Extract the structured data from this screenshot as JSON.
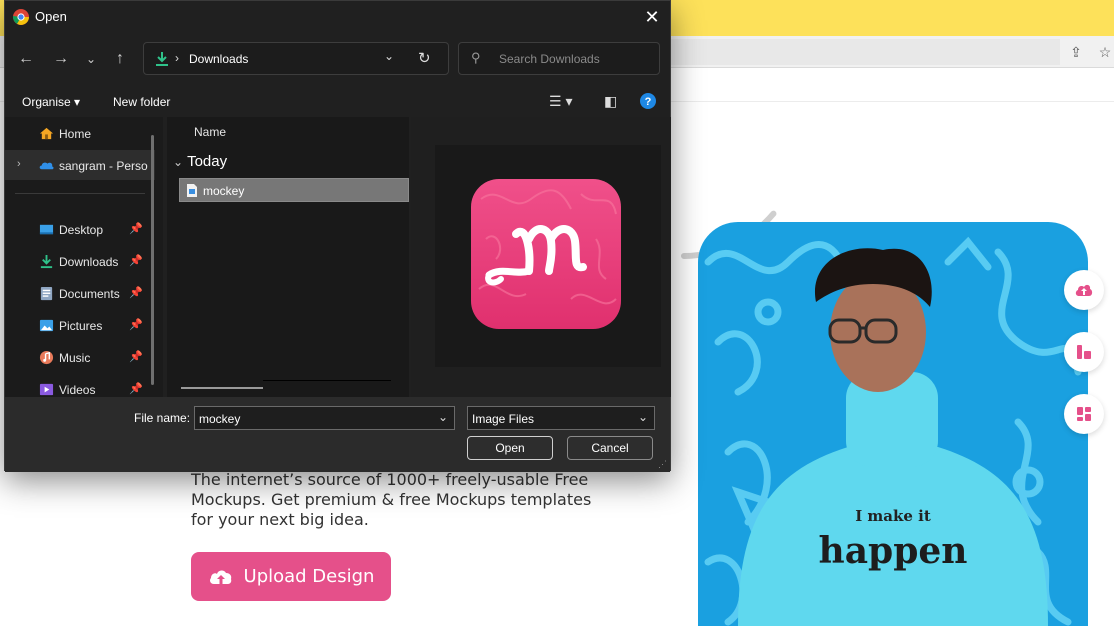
{
  "dialog": {
    "title": "Open",
    "address": {
      "location": "Downloads",
      "separator": "›"
    },
    "search": {
      "placeholder": "Search Downloads"
    },
    "commands": {
      "organise": "Organise",
      "new_folder": "New folder"
    },
    "nav_items": [
      {
        "label": "Home"
      },
      {
        "label": "sangram - Perso"
      },
      {
        "label": "Desktop"
      },
      {
        "label": "Downloads"
      },
      {
        "label": "Documents"
      },
      {
        "label": "Pictures"
      },
      {
        "label": "Music"
      },
      {
        "label": "Videos"
      }
    ],
    "file_list": {
      "column_name": "Name",
      "group": "Today",
      "files": [
        {
          "name": "mockey"
        }
      ]
    },
    "bottom": {
      "file_name_label": "File name:",
      "file_name_value": "mockey",
      "file_type": "Image Files",
      "open_label": "Open",
      "cancel_label": "Cancel"
    }
  },
  "page": {
    "hero_text": "The internet’s source of 1000+ freely-usable Free Mockups. Get premium & free Mockups templates for your next big idea.",
    "upload_button": "Upload Design",
    "tshirt_text_1": "I make it",
    "tshirt_text_2": "happen"
  },
  "colors": {
    "accent_pink": "#e5508a",
    "banner_yellow": "#fde15a",
    "dialog_bg": "#202020",
    "selection": "#777777",
    "hero_blue": "#1aa0e0"
  }
}
